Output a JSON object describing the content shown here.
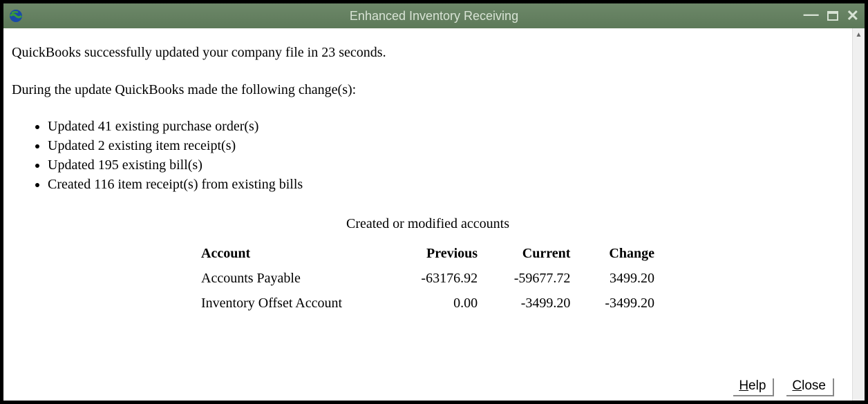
{
  "window": {
    "title": "Enhanced Inventory Receiving"
  },
  "body": {
    "intro_prefix": "QuickBooks successfully updated your company file in ",
    "intro_seconds": "23",
    "intro_suffix": " seconds.",
    "changes_intro": "During the update QuickBooks made the following change(s):",
    "changes": [
      "Updated 41 existing purchase order(s)",
      "Updated 2 existing item receipt(s)",
      "Updated 195 existing bill(s)",
      "Created 116 item receipt(s) from existing bills"
    ],
    "table_caption": "Created or modified accounts",
    "table_headers": {
      "account": "Account",
      "previous": "Previous",
      "current": "Current",
      "change": "Change"
    },
    "table_rows": [
      {
        "account": "Accounts Payable",
        "previous": "-63176.92",
        "current": "-59677.72",
        "change": "3499.20"
      },
      {
        "account": "Inventory Offset Account",
        "previous": "0.00",
        "current": "-3499.20",
        "change": "-3499.20"
      }
    ]
  },
  "buttons": {
    "help_u": "H",
    "help_rest": "elp",
    "close_u": "C",
    "close_rest": "lose"
  }
}
